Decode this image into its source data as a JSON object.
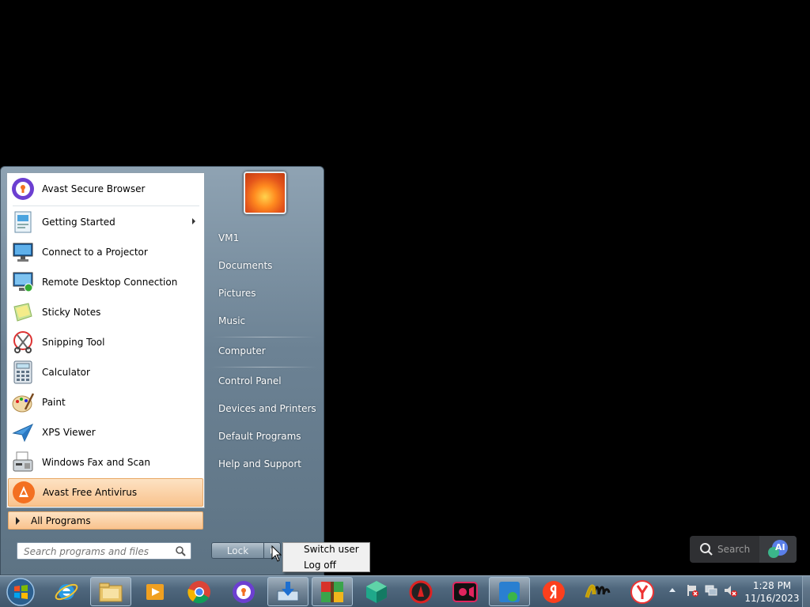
{
  "start_menu": {
    "pinned": [
      {
        "label": "Avast Secure Browser",
        "icon": "avast-browser-icon"
      },
      {
        "label": "Getting Started",
        "icon": "getting-started-icon",
        "submenu": true
      },
      {
        "label": "Connect to a Projector",
        "icon": "projector-icon"
      },
      {
        "label": "Remote Desktop Connection",
        "icon": "remote-desktop-icon"
      },
      {
        "label": "Sticky Notes",
        "icon": "sticky-notes-icon"
      },
      {
        "label": "Snipping Tool",
        "icon": "snipping-tool-icon"
      },
      {
        "label": "Calculator",
        "icon": "calculator-icon"
      },
      {
        "label": "Paint",
        "icon": "paint-icon"
      },
      {
        "label": "XPS Viewer",
        "icon": "xps-viewer-icon"
      },
      {
        "label": "Windows Fax and Scan",
        "icon": "fax-scan-icon"
      },
      {
        "label": "Avast Free Antivirus",
        "icon": "avast-antivirus-icon",
        "highlighted": true
      }
    ],
    "all_programs": "All Programs",
    "search_placeholder": "Search programs and files",
    "right_links": [
      "VM1",
      "Documents",
      "Pictures",
      "Music",
      "Computer",
      "Control Panel",
      "Devices and Printers",
      "Default Programs",
      "Help and Support"
    ],
    "shutdown_button": "Lock",
    "shutdown_menu": [
      "Switch user",
      "Log off"
    ]
  },
  "desktop_search": {
    "placeholder": "Search",
    "ai_label": "AI"
  },
  "taskbar": {
    "start_icon": "windows-orb-icon",
    "apps": [
      {
        "name": "internet-explorer-icon",
        "running": false
      },
      {
        "name": "file-explorer-icon",
        "running": true
      },
      {
        "name": "media-player-icon",
        "running": false
      },
      {
        "name": "chrome-icon",
        "running": false
      },
      {
        "name": "avast-browser-icon",
        "running": false
      },
      {
        "name": "downloader-icon",
        "running": true
      },
      {
        "name": "winrar-icon",
        "running": true
      },
      {
        "name": "green-cube-icon",
        "running": false
      },
      {
        "name": "driver-booster-icon",
        "running": false
      },
      {
        "name": "screen-recorder-icon",
        "running": false
      },
      {
        "name": "iobit-icon",
        "running": true
      },
      {
        "name": "yandex-icon",
        "running": false
      },
      {
        "name": "scribble-app-icon",
        "running": false
      },
      {
        "name": "yandex-browser-icon",
        "running": false
      }
    ],
    "clock_time": "1:28 PM",
    "clock_date": "11/16/2023"
  },
  "colors": {
    "highlight": "#f9c38e",
    "menu_glass": "#6c8294",
    "taskbar": "#4f677d"
  }
}
